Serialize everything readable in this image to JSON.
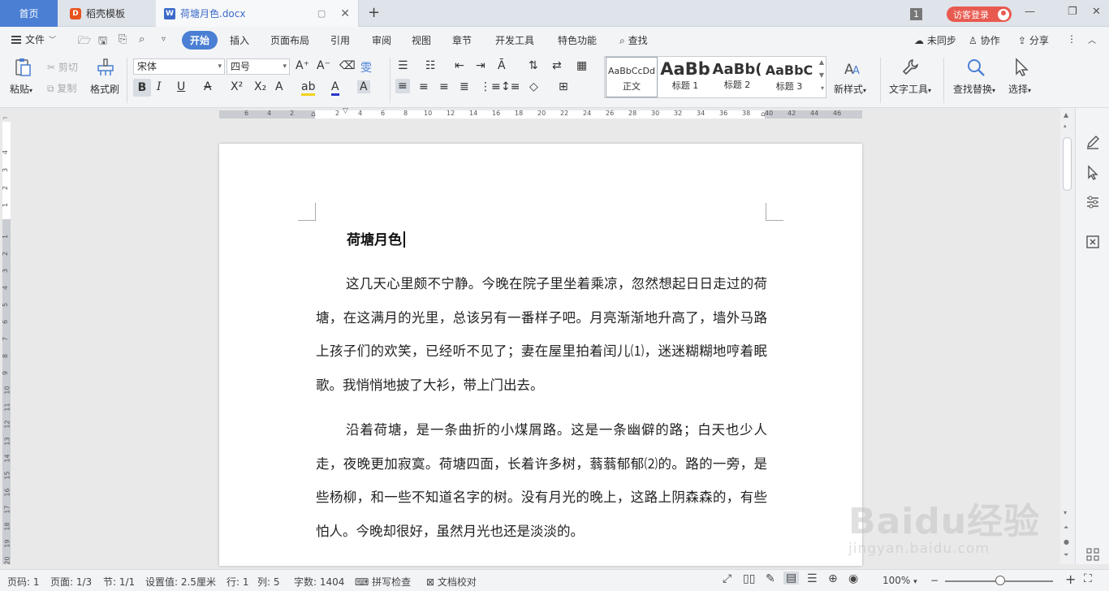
{
  "tabs": {
    "home": "首页",
    "template": "稻壳模板",
    "document": "荷塘月色.docx",
    "new_tab": "+",
    "window_count": "1",
    "login": "访客登录"
  },
  "menu": {
    "file": "文件",
    "items": [
      "开始",
      "插入",
      "页面布局",
      "引用",
      "审阅",
      "视图",
      "章节",
      "开发工具",
      "特色功能"
    ],
    "search": "查找",
    "right": [
      "未同步",
      "协作",
      "分享"
    ]
  },
  "ribbon": {
    "paste": "粘贴",
    "cut": "剪切",
    "copy": "复制",
    "format_painter": "格式刷",
    "font_name": "宋体",
    "font_size": "四号",
    "styles": [
      {
        "preview": "AaBbCcDd",
        "label": "正文"
      },
      {
        "preview": "AaBb",
        "label": "标题 1"
      },
      {
        "preview": "AaBb(",
        "label": "标题 2"
      },
      {
        "preview": "AaBbC",
        "label": "标题 3"
      }
    ],
    "new_style": "新样式",
    "text_tools": "文字工具",
    "find_replace": "查找替换",
    "select": "选择"
  },
  "ruler": {
    "h_ticks": [
      "6",
      "4",
      "2",
      "2",
      "4",
      "6",
      "8",
      "10",
      "12",
      "14",
      "16",
      "18",
      "20",
      "22",
      "24",
      "26",
      "28",
      "30",
      "32",
      "34",
      "36",
      "38",
      "40",
      "42",
      "44",
      "46"
    ],
    "v_ticks_top": [
      "4",
      "3",
      "2",
      "1"
    ],
    "v_ticks": [
      "1",
      "2",
      "3",
      "4",
      "5",
      "6",
      "7",
      "8",
      "9",
      "10",
      "11",
      "12",
      "13",
      "14",
      "15",
      "16",
      "17",
      "18",
      "19",
      "20"
    ]
  },
  "document": {
    "title": "荷塘月色",
    "paragraphs": [
      "这几天心里颇不宁静。今晚在院子里坐着乘凉，忽然想起日日走过的荷塘，在这满月的光里，总该另有一番样子吧。月亮渐渐地升高了，墙外马路上孩子们的欢笑，已经听不见了；妻在屋里拍着闰儿⑴，迷迷糊糊地哼着眠歌。我悄悄地披了大衫，带上门出去。",
      "沿着荷塘，是一条曲折的小煤屑路。这是一条幽僻的路；白天也少人走，夜晚更加寂寞。荷塘四面，长着许多树，蓊蓊郁郁⑵的。路的一旁，是些杨柳，和一些不知道名字的树。没有月光的晚上，这路上阴森森的，有些怕人。今晚却很好，虽然月光也还是淡淡的。"
    ]
  },
  "status": {
    "page_num": "页码: 1",
    "pages": "页面: 1/3",
    "section": "节: 1/1",
    "setting": "设置值: 2.5厘米",
    "row": "行: 1",
    "col": "列: 5",
    "words": "字数: 1404",
    "spell": "拼写检查",
    "proof": "文档校对",
    "zoom": "100%",
    "zoom_level": 1.0
  },
  "watermark": {
    "brand": "Baidu经验",
    "url": "jingyan.baidu.com"
  },
  "colors": {
    "accent": "#4a7fd4",
    "login": "#e85a4f",
    "template_logo": "#e8531e"
  }
}
